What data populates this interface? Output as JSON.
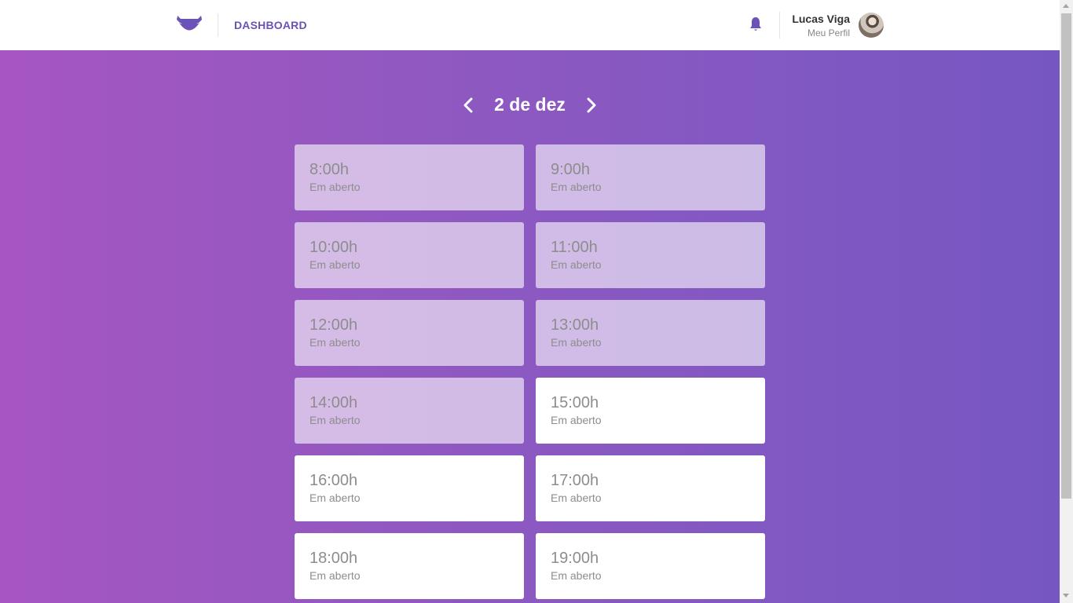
{
  "header": {
    "logo_icon": "mustache-icon",
    "title": "DASHBOARD",
    "notification_icon": "bell-icon",
    "user": {
      "name": "Lucas Viga",
      "subtitle": "Meu Perfil"
    }
  },
  "schedule": {
    "date_label": "2 de dez",
    "prev_icon": "chevron-left-icon",
    "next_icon": "chevron-right-icon",
    "slots": [
      {
        "time": "8:00h",
        "status": "Em aberto",
        "state": "past"
      },
      {
        "time": "9:00h",
        "status": "Em aberto",
        "state": "past"
      },
      {
        "time": "10:00h",
        "status": "Em aberto",
        "state": "past"
      },
      {
        "time": "11:00h",
        "status": "Em aberto",
        "state": "past"
      },
      {
        "time": "12:00h",
        "status": "Em aberto",
        "state": "past"
      },
      {
        "time": "13:00h",
        "status": "Em aberto",
        "state": "past"
      },
      {
        "time": "14:00h",
        "status": "Em aberto",
        "state": "past"
      },
      {
        "time": "15:00h",
        "status": "Em aberto",
        "state": "available"
      },
      {
        "time": "16:00h",
        "status": "Em aberto",
        "state": "available"
      },
      {
        "time": "17:00h",
        "status": "Em aberto",
        "state": "available"
      },
      {
        "time": "18:00h",
        "status": "Em aberto",
        "state": "available"
      },
      {
        "time": "19:00h",
        "status": "Em aberto",
        "state": "available"
      }
    ]
  },
  "colors": {
    "brand": "#6b52b6",
    "gradient_start": "#a656c1",
    "gradient_end": "#7657c2"
  }
}
